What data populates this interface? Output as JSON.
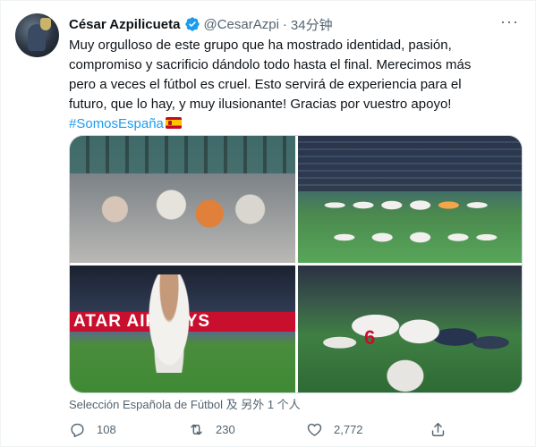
{
  "tweet": {
    "author_name": "César Azpilicueta",
    "handle": "@CesarAzpi",
    "separator": "·",
    "time": "34分钟",
    "text_line1": "Muy orgulloso de este grupo que ha mostrado identidad, pasión,",
    "text_line2": "compromiso y sacrificio dándolo todo hasta el final. Merecimos más",
    "text_line3": "pero a veces el fútbol es cruel. Esto servirá de experiencia para el",
    "text_line4": "futuro, que lo hay, y muy ilusionante! Gracias por vuestro apoyo!",
    "hashtag": "#SomosEspaña",
    "more_label": "···"
  },
  "media": {
    "banner_text": "ATAR AIRWAYS",
    "jersey_number": "6"
  },
  "tagged": "Selección Española de Fútbol 及 另外 1 个人",
  "actions": {
    "replies": "108",
    "retweets": "230",
    "likes": "2,772"
  },
  "colors": {
    "accent": "#1d9bf0",
    "text": "#0f1419",
    "muted": "#536471"
  },
  "icons": {
    "verified": "verified-badge-icon",
    "reply": "reply-icon",
    "retweet": "retweet-icon",
    "like": "heart-icon",
    "share": "share-icon",
    "more": "more-icon",
    "flag": "spain-flag-icon"
  }
}
